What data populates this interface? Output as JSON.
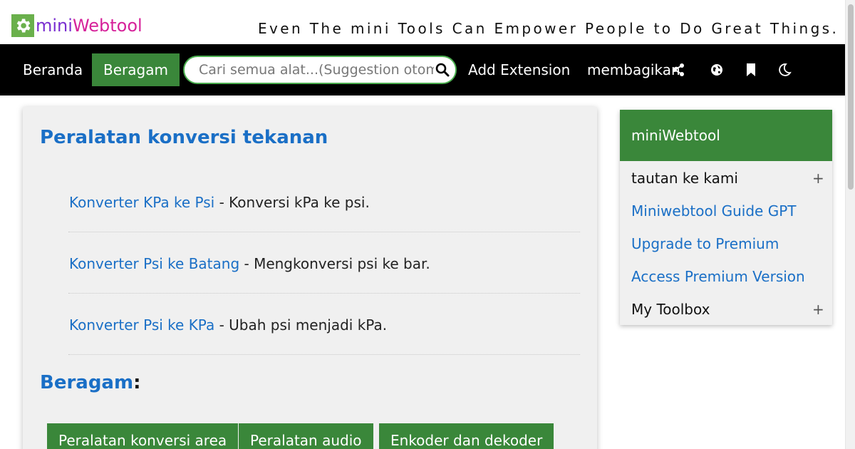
{
  "header": {
    "logo_mini": "mini",
    "logo_web": "Webtool",
    "slogan": "Even The mini Tools Can Empower People to Do Great Things."
  },
  "nav": {
    "home": "Beranda",
    "active": "Beragam",
    "search_placeholder": "Cari semua alat...(Suggestion otomatis)",
    "add_extension": "Add Extension",
    "share": "membagikan",
    "icons": [
      "share-icon",
      "globe-icon",
      "bookmark-icon",
      "moon-icon"
    ]
  },
  "main": {
    "title": "Peralatan konversi tekanan",
    "tools": [
      {
        "name": "Konverter KPa ke Psi",
        "desc": " - Konversi kPa ke psi."
      },
      {
        "name": "Konverter Psi ke Batang",
        "desc": " - Mengkonversi psi ke bar."
      },
      {
        "name": "Konverter Psi ke KPa",
        "desc": " - Ubah psi menjadi kPa."
      }
    ],
    "section_title": "Beragam",
    "section_colon": ":",
    "categories": [
      "Peralatan konversi area",
      "Peralatan audio",
      "Enkoder dan dekoder"
    ]
  },
  "sidebar": {
    "title": "miniWebtool",
    "items": [
      {
        "label": "tautan ke kami",
        "expand": "+"
      },
      {
        "label": "Miniwebtool Guide GPT"
      },
      {
        "label": "Upgrade to Premium"
      },
      {
        "label": "Access Premium Version"
      },
      {
        "label": "My Toolbox",
        "expand": "+"
      }
    ]
  },
  "colors": {
    "green": "#3a873a",
    "link": "#1a6fc6",
    "nav_bg": "#000000"
  }
}
